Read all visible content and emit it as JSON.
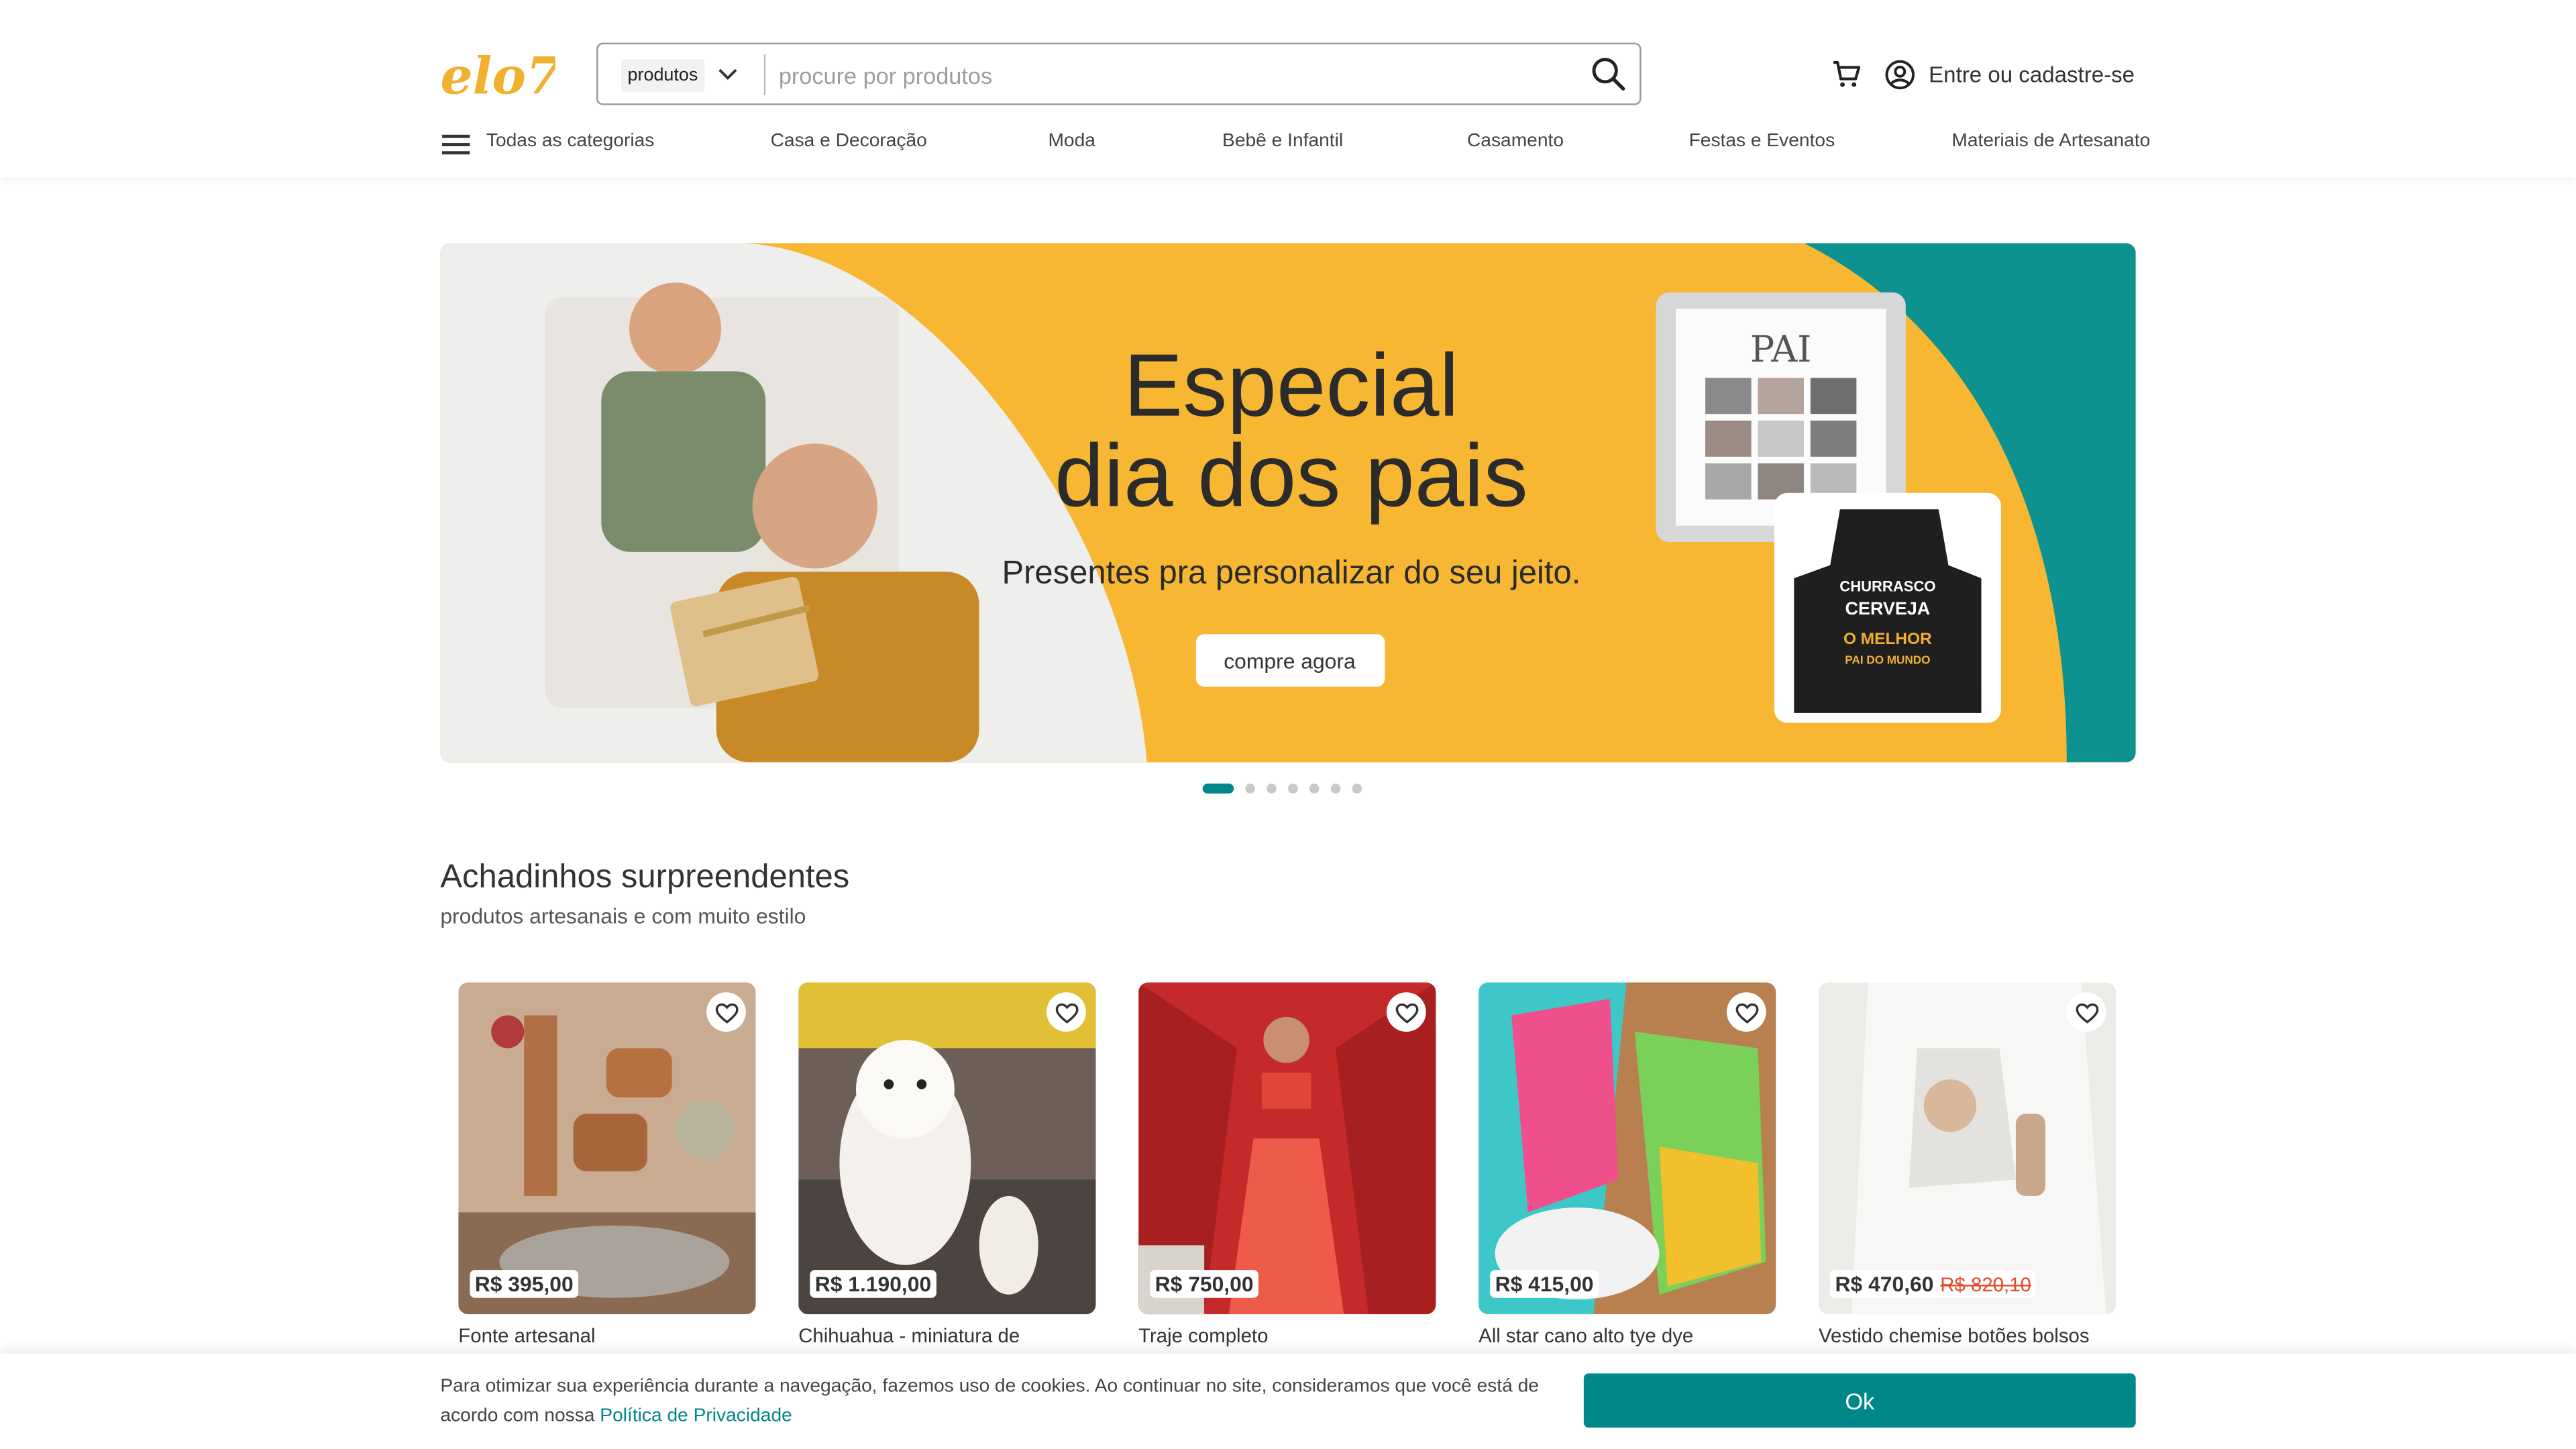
{
  "header": {
    "logo_text": "elo7",
    "search": {
      "scope_label": "produtos",
      "placeholder": "procure por produtos"
    },
    "login_label": "Entre ou cadastre-se"
  },
  "nav": {
    "all_categories": "Todas as categorias",
    "items": [
      "Casa e Decoração",
      "Moda",
      "Bebê e Infantil",
      "Casamento",
      "Festas e Eventos",
      "Materiais de Artesanato"
    ]
  },
  "banner": {
    "title_line1": "Especial",
    "title_line2": "dia dos pais",
    "subtitle": "Presentes pra personalizar do seu jeito.",
    "cta": "compre agora",
    "apron_text": [
      "CHURRASCO",
      "CERVEJA",
      "O MELHOR",
      "PAI DO MUNDO"
    ],
    "frame_text": "PAI",
    "slides": 7,
    "active_slide": 1
  },
  "section": {
    "title": "Achadinhos surpreendentes",
    "subtitle": "produtos artesanais e com muito estilo"
  },
  "products": [
    {
      "name": "Fonte artesanal",
      "price": "R$ 395,00",
      "old_price": ""
    },
    {
      "name": "Chihuahua - miniatura de",
      "price": "R$ 1.190,00",
      "old_price": ""
    },
    {
      "name": "Traje completo",
      "price": "R$ 750,00",
      "old_price": ""
    },
    {
      "name": "All star cano alto tye dye",
      "price": "R$ 415,00",
      "old_price": ""
    },
    {
      "name": "Vestido chemise botões bolsos",
      "price": "R$ 470,60",
      "old_price": "R$ 820,10"
    }
  ],
  "cookie": {
    "text": "Para otimizar sua experiência durante a navegação, fazemos uso de cookies. Ao continuar no site, consideramos que você está de acordo com nossa",
    "link": "Política de Privacidade",
    "ok": "Ok"
  },
  "colors": {
    "brand_yellow": "#f7b733",
    "teal": "#00878a",
    "sale_red": "#e24a2b"
  }
}
